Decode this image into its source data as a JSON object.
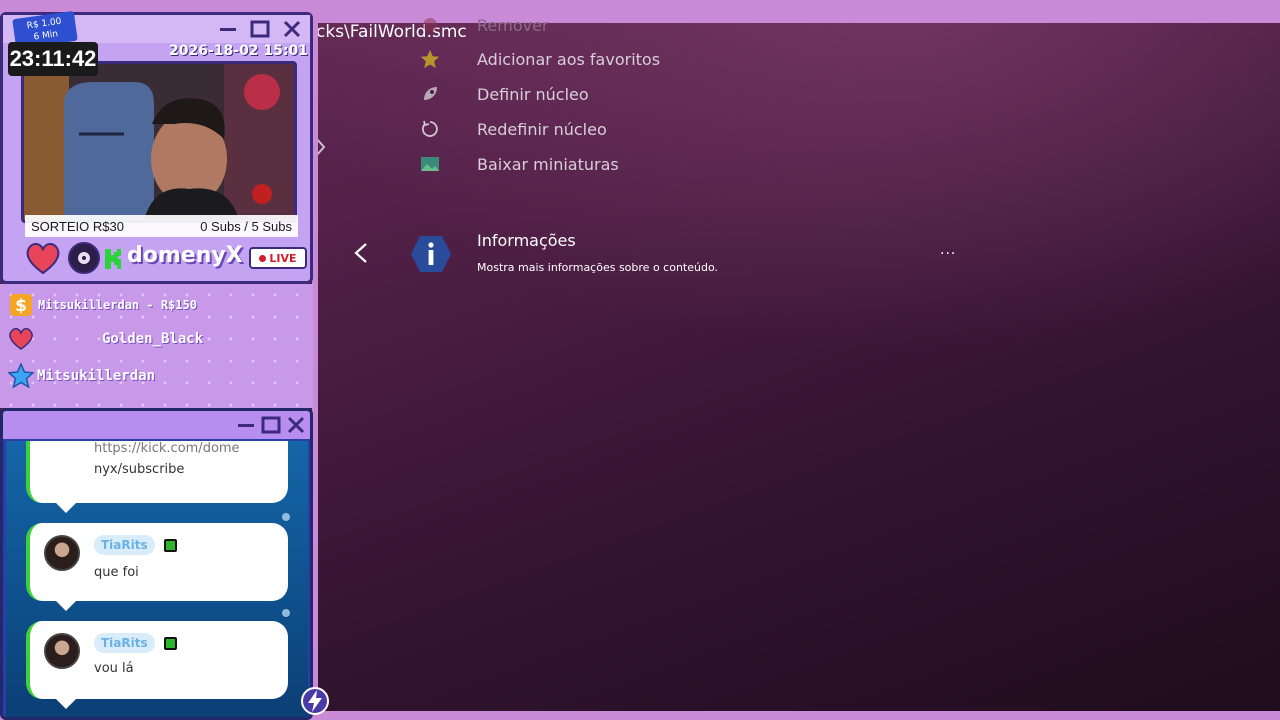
{
  "menu": {
    "path_fragment": "cks\\FailWorld.smc",
    "items": [
      {
        "label": "Remover",
        "icon": "remove-icon"
      },
      {
        "label": "Adicionar aos favoritos",
        "icon": "star-icon"
      },
      {
        "label": "Definir núcleo",
        "icon": "core-icon"
      },
      {
        "label": "Redefinir núcleo",
        "icon": "reset-icon"
      },
      {
        "label": "Baixar miniaturas",
        "icon": "thumbnail-icon"
      }
    ],
    "info": {
      "title": "Informações",
      "subtitle": "Mostra mais informações sobre o conteúdo.",
      "more": "...",
      "icon": "info-icon"
    }
  },
  "overlay": {
    "price_tag": {
      "line1": "R$ 1.00",
      "line2": "6 Min"
    },
    "timer": "23:11:42",
    "date": "2026-18-02 15:01",
    "caption_left": "SORTEIO R$30",
    "caption_right": "0 Subs / 5 Subs",
    "streamer": "domenyX",
    "live": "LIVE",
    "alerts": [
      {
        "icon": "dollar-icon",
        "text": "Mitsukillerdan  - R$150"
      },
      {
        "icon": "heart-icon",
        "text": "Golden_Black"
      },
      {
        "icon": "star-icon",
        "text": "Mitsukillerdan"
      }
    ],
    "chat": {
      "messages": [
        {
          "user": "",
          "text_line1": "https://kick.com/dome",
          "text_line2": "nyx/subscribe"
        },
        {
          "user": "TiaRits",
          "text": "que foi"
        },
        {
          "user": "TiaRits",
          "text": "vou lá"
        }
      ]
    }
  },
  "colors": {
    "accent_purple": "#c98ad8",
    "window_border": "#3c2a7c",
    "chat_bg": "#1565a8",
    "bubble_accent": "#3dd13a"
  }
}
